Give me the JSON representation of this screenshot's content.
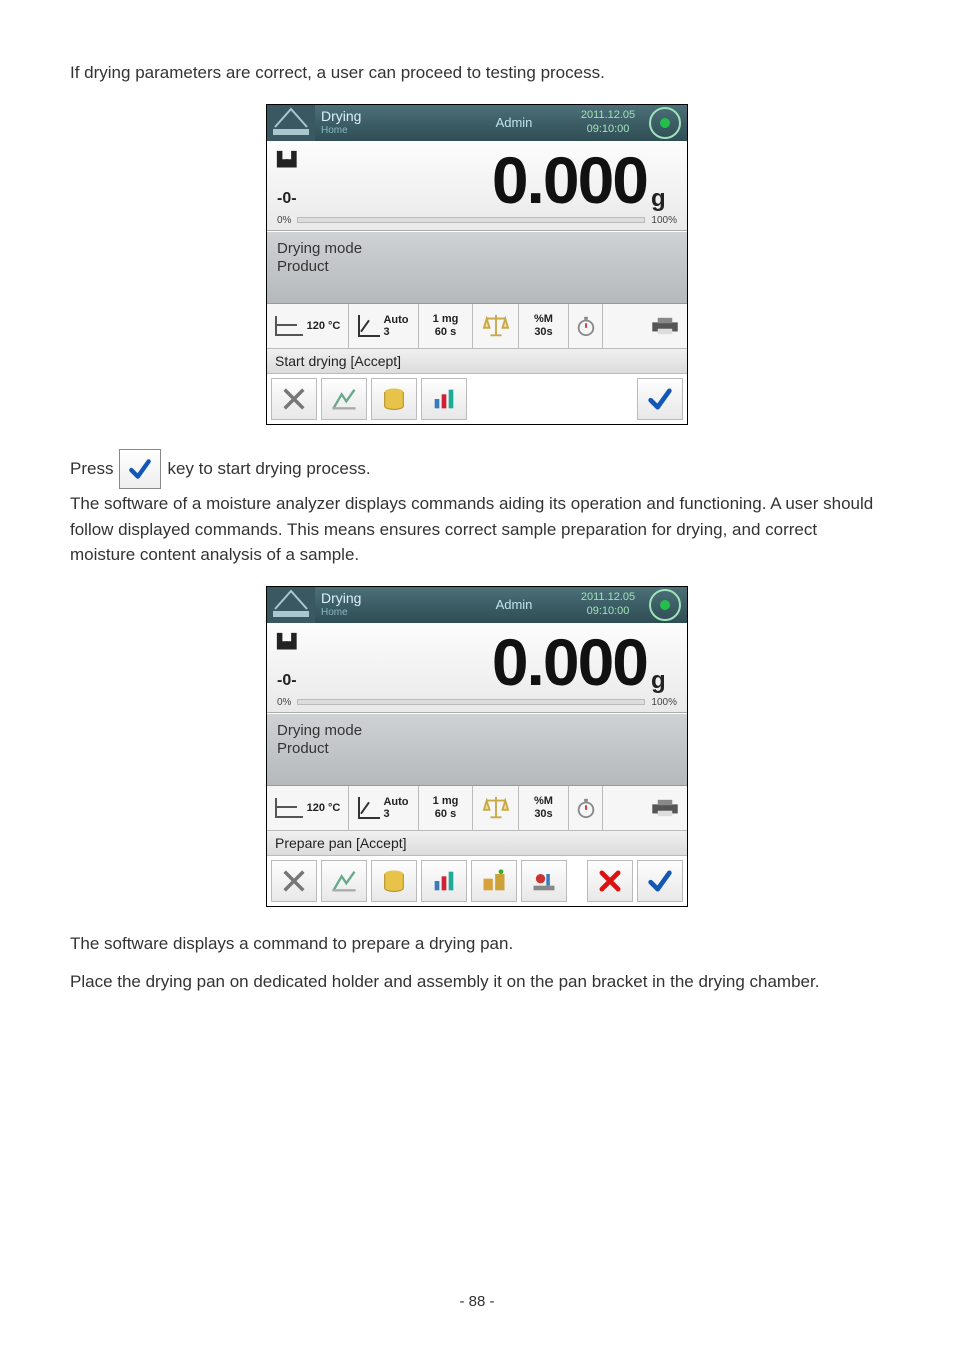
{
  "para1": "If drying parameters are correct, a user can proceed to testing process.",
  "press_pre": "Press",
  "press_post": " key to start drying process.",
  "para2": "The software of a moisture analyzer displays commands aiding its operation and functioning. A user should follow displayed commands. This means ensures correct sample preparation for drying, and correct moisture content analysis of a sample.",
  "para3": "The software displays a command to prepare a drying pan.",
  "para4": "Place the drying pan on dedicated holder and assembly it on the pan bracket in the drying chamber.",
  "footer": "- 88 -",
  "screen": {
    "title": "Drying",
    "subtitle": "Home",
    "admin": "Admin",
    "date": "2011.12.05",
    "time": "09:10:00",
    "value": "0.000",
    "unit": "g",
    "zero": "-0-",
    "bar_left": "0%",
    "bar_right": "100%",
    "mode_line1": "Drying mode",
    "mode_line2": "Product",
    "temp": "120 °C",
    "auto_label": "Auto",
    "auto_num": "3",
    "mg": "1 mg",
    "sec": "60 s",
    "pctM": "%M",
    "s30": "30s"
  },
  "status1": "Start drying [Accept]",
  "status2": "Prepare pan [Accept]"
}
